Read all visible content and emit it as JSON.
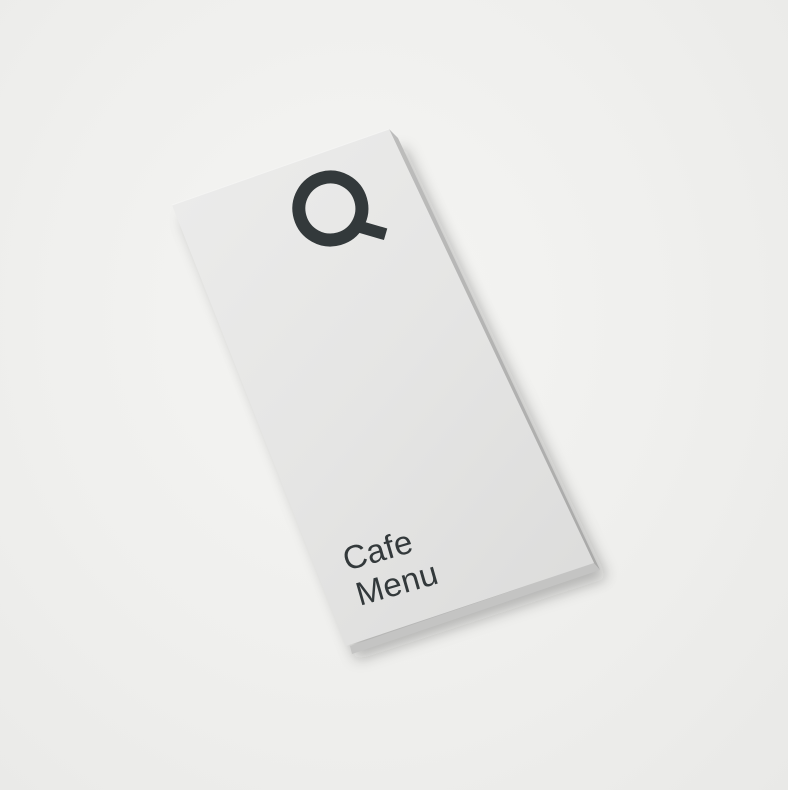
{
  "brochure": {
    "logo_icon": "magnifier-q-logo-icon",
    "title_line_1": "Cafe",
    "title_line_2": "Menu"
  },
  "colors": {
    "background": "#efefed",
    "paper": "#e6e6e5",
    "ink": "#33393b"
  }
}
